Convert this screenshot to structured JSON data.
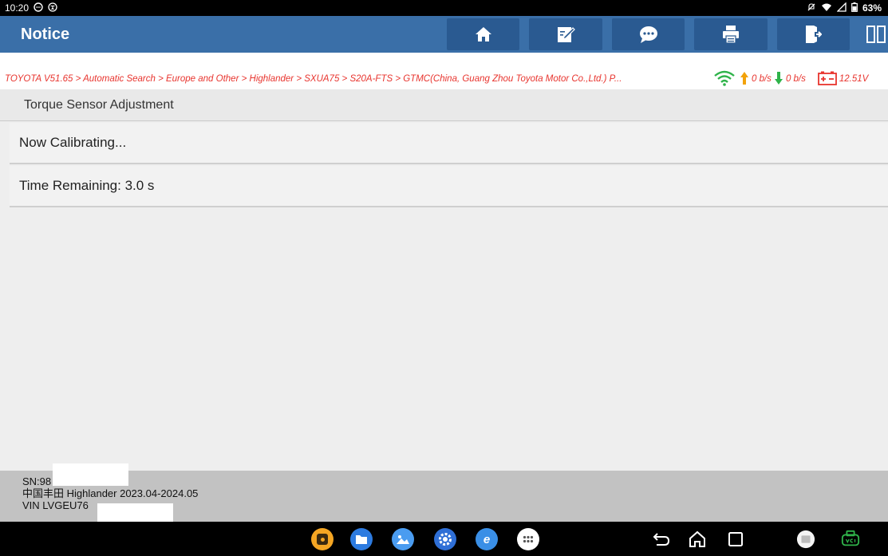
{
  "status_bar": {
    "time": "10:20",
    "battery": "63%"
  },
  "title_bar": {
    "title": "Notice",
    "buttons": [
      "home-icon",
      "edit-note-icon",
      "chat-icon",
      "print-icon",
      "exit-icon",
      "split-screen-icon"
    ]
  },
  "breadcrumb": {
    "path": "TOYOTA V51.65 > Automatic Search > Europe and Other > Highlander > SXUA75 > S20A-FTS > GTMC(China, Guang Zhou Toyota Motor Co.,Ltd.) P...",
    "upload_speed": "0 b/s",
    "download_speed": "0 b/s",
    "voltage": "12.51V",
    "colors": {
      "path": "#e8342e",
      "wifi": "#2fb34a",
      "upload": "#f2a20a",
      "download": "#2fb34a"
    }
  },
  "main": {
    "section_title": "Torque Sensor Adjustment",
    "rows": [
      {
        "text": "Now Calibrating..."
      },
      {
        "text": "Time Remaining: 3.0 s"
      }
    ]
  },
  "footer": {
    "sn": "SN:98",
    "vehicle": "中国丰田 Highlander 2023.04-2024.05",
    "vin": "VIN LVGEU76"
  },
  "nav_bar": {
    "apps": [
      "diagnostic-app-icon",
      "files-app-icon",
      "gallery-app-icon",
      "settings-app-icon",
      "browser-app-icon",
      "app-drawer-icon"
    ],
    "controls": [
      "back-icon",
      "home-nav-icon",
      "recents-icon",
      "screenshot-icon",
      "vci-icon"
    ]
  },
  "accent_color": "#3a6fa8"
}
